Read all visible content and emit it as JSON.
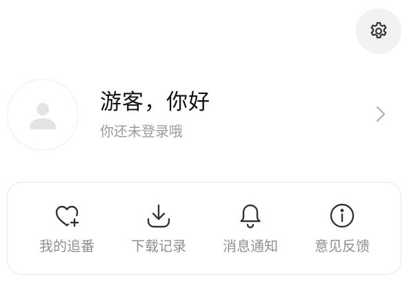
{
  "header": {
    "settings_icon": "gear-icon"
  },
  "profile": {
    "avatar_icon": "user-silhouette-icon",
    "greeting": "游客，你好",
    "subtext": "你还未登录哦",
    "chevron_icon": "chevron-right-icon"
  },
  "actions": [
    {
      "label": "我的追番",
      "icon": "heart-plus-icon"
    },
    {
      "label": "下载记录",
      "icon": "download-icon"
    },
    {
      "label": "消息通知",
      "icon": "bell-icon"
    },
    {
      "label": "意见反馈",
      "icon": "info-icon"
    }
  ],
  "colors": {
    "text_primary": "#111111",
    "text_secondary": "#9a9a9a",
    "icon": "#333333",
    "gear_bg": "#f2f2f2",
    "border": "#e6e6e6"
  }
}
